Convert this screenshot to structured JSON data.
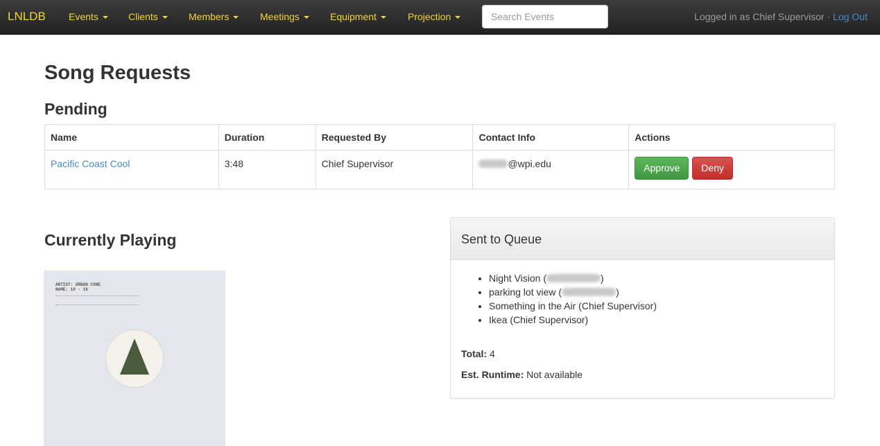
{
  "navbar": {
    "brand": "LNLDB",
    "menus": [
      "Events",
      "Clients",
      "Members",
      "Meetings",
      "Equipment",
      "Projection"
    ],
    "search_placeholder": "Search Events",
    "login_prefix": "Logged in as Chief Supervisor",
    "separator": "·",
    "logout_label": "Log Out"
  },
  "page": {
    "title": "Song Requests",
    "pending_heading": "Pending",
    "playing_heading": "Currently Playing"
  },
  "pending_table": {
    "headers": [
      "Name",
      "Duration",
      "Requested By",
      "Contact Info",
      "Actions"
    ],
    "rows": [
      {
        "name": "Pacific Coast Cool",
        "duration": "3:48",
        "requested_by": "Chief Supervisor",
        "contact_suffix": "@wpi.edu",
        "approve_label": "Approve",
        "deny_label": "Deny"
      }
    ]
  },
  "album": {
    "artist_line": "ARTIST: URBAN CONE",
    "name_line": "NAME: 10 - 16"
  },
  "queue_panel": {
    "title": "Sent to Queue",
    "items": [
      {
        "song": "Night Vision",
        "requester": "",
        "redacted": true
      },
      {
        "song": "parking lot view",
        "requester": "",
        "redacted": true
      },
      {
        "song": "Something in the Air",
        "requester": "Chief Supervisor",
        "redacted": false
      },
      {
        "song": "Ikea",
        "requester": "Chief Supervisor",
        "redacted": false
      }
    ],
    "total_label": "Total:",
    "total_value": "4",
    "runtime_label": "Est. Runtime:",
    "runtime_value": "Not available"
  },
  "colors": {
    "navbar_link": "#f5d33a",
    "link": "#428bca",
    "approve": "#5cb85c",
    "deny": "#d9534f"
  }
}
